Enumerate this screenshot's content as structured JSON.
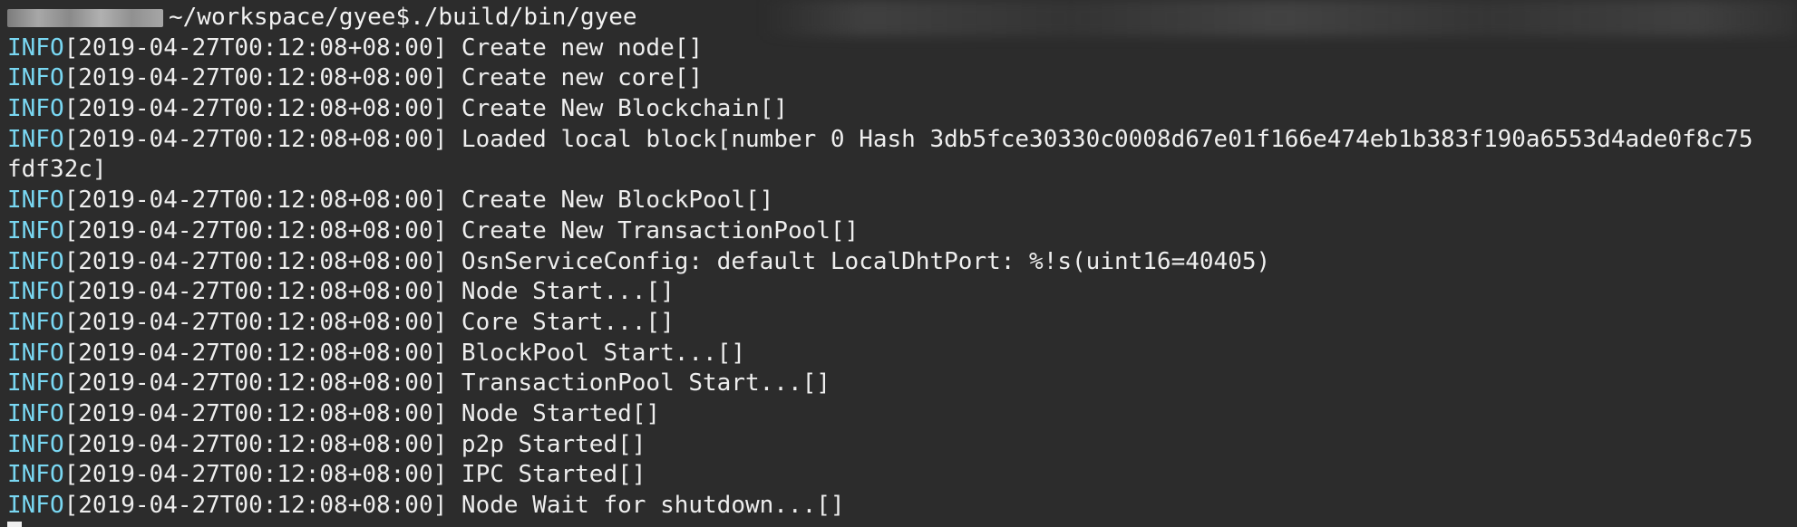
{
  "prompt": {
    "path": "~/workspace/gyee$",
    "command": "./build/bin/gyee"
  },
  "log_lines": [
    {
      "level": "INFO",
      "text": "[2019-04-27T00:12:08+08:00] Create new node[]"
    },
    {
      "level": "INFO",
      "text": "[2019-04-27T00:12:08+08:00] Create new core[]"
    },
    {
      "level": "INFO",
      "text": "[2019-04-27T00:12:08+08:00] Create New Blockchain[]"
    },
    {
      "level": "INFO",
      "text": "[2019-04-27T00:12:08+08:00] Loaded local block[number 0 Hash 3db5fce30330c0008d67e01f166e474eb1b383f190a6553d4ade0f8c75"
    },
    {
      "level": "",
      "text": "fdf32c]"
    },
    {
      "level": "INFO",
      "text": "[2019-04-27T00:12:08+08:00] Create New BlockPool[]"
    },
    {
      "level": "INFO",
      "text": "[2019-04-27T00:12:08+08:00] Create New TransactionPool[]"
    },
    {
      "level": "INFO",
      "text": "[2019-04-27T00:12:08+08:00] OsnServiceConfig: default LocalDhtPort: %!s(uint16=40405)"
    },
    {
      "level": "INFO",
      "text": "[2019-04-27T00:12:08+08:00] Node Start...[]"
    },
    {
      "level": "INFO",
      "text": "[2019-04-27T00:12:08+08:00] Core Start...[]"
    },
    {
      "level": "INFO",
      "text": "[2019-04-27T00:12:08+08:00] BlockPool Start...[]"
    },
    {
      "level": "INFO",
      "text": "[2019-04-27T00:12:08+08:00] TransactionPool Start...[]"
    },
    {
      "level": "INFO",
      "text": "[2019-04-27T00:12:08+08:00] Node Started[]"
    },
    {
      "level": "INFO",
      "text": "[2019-04-27T00:12:08+08:00] p2p Started[]"
    },
    {
      "level": "INFO",
      "text": "[2019-04-27T00:12:08+08:00] IPC Started[]"
    },
    {
      "level": "INFO",
      "text": "[2019-04-27T00:12:08+08:00] Node Wait for shutdown...[]"
    }
  ],
  "colors": {
    "background": "#2c2c2c",
    "info_level": "#79d7f2",
    "text": "#eeeeee"
  }
}
